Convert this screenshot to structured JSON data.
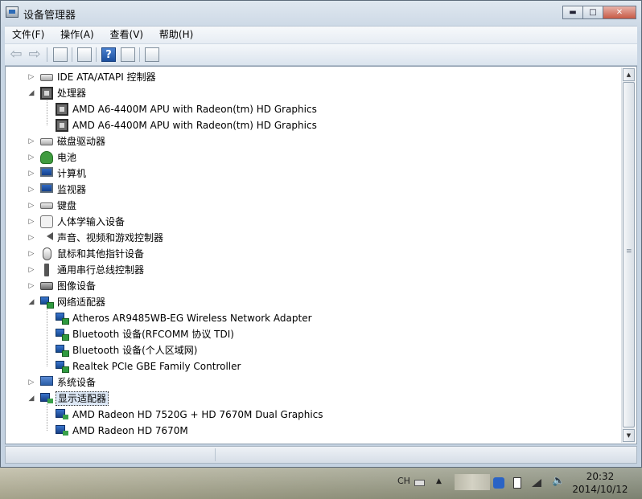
{
  "window": {
    "title": "设备管理器"
  },
  "caption_buttons": {
    "minimize": "▬",
    "maximize": "□",
    "close": "✕"
  },
  "menu": {
    "file": "文件(F)",
    "action": "操作(A)",
    "view": "查看(V)",
    "help": "帮助(H)"
  },
  "tree": {
    "ide": "IDE ATA/ATAPI 控制器",
    "processors": "处理器",
    "cpu1": "AMD A6-4400M APU with Radeon(tm) HD Graphics",
    "cpu2": "AMD A6-4400M APU with Radeon(tm) HD Graphics",
    "disk": "磁盘驱动器",
    "battery": "电池",
    "computer": "计算机",
    "monitors": "监视器",
    "keyboard": "键盘",
    "hid": "人体学输入设备",
    "sound": "声音、视频和游戏控制器",
    "mouse": "鼠标和其他指针设备",
    "usb": "通用串行总线控制器",
    "imaging": "图像设备",
    "network": "网络适配器",
    "net1": "Atheros AR9485WB-EG Wireless Network Adapter",
    "net2": "Bluetooth 设备(RFCOMM 协议 TDI)",
    "net3": "Bluetooth 设备(个人区域网)",
    "net4": "Realtek PCIe GBE Family Controller",
    "system": "系统设备",
    "display": "显示适配器",
    "gpu1": "AMD Radeon HD 7520G + HD 7670M Dual Graphics",
    "gpu2": "AMD Radeon HD 7670M"
  },
  "taskbar": {
    "ime": "CH",
    "time": "20:32",
    "date": "2014/10/12"
  }
}
